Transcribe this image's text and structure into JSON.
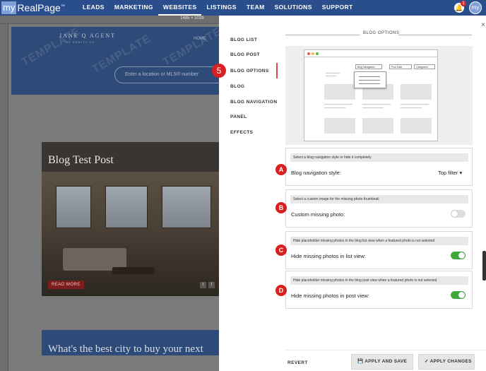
{
  "app": {
    "logo_my": "my",
    "logo_brand": "RealPage",
    "logo_tm": "™",
    "nav": [
      "LEADS",
      "MARKETING",
      "WEBSITES",
      "LISTINGS",
      "TEAM",
      "SOLUTIONS",
      "SUPPORT"
    ],
    "active_nav": "WEBSITES",
    "notification_count": "1",
    "avatar_text": "my"
  },
  "preview": {
    "dimensions": "1485 × 1039",
    "agent_name": "JANE Q AGENT",
    "agent_brand": "THE REALTY CO",
    "home_link": "HOME",
    "watermark": "TEMPLATE",
    "search_placeholder": "Enter a location or MLS® number",
    "blog_title": "Blog Test Post",
    "read_more": "READ MORE",
    "blog2_title": "What's the best city to buy your next"
  },
  "panel": {
    "nav_items": [
      "BLOG LIST",
      "BLOG POST",
      "BLOG OPTIONS",
      "BLOG",
      "BLOG NAVIGATION",
      "PANEL",
      "EFFECTS"
    ],
    "active_item": "BLOG OPTIONS",
    "step_number": "5",
    "close_label": "×",
    "section_title": "BLOG OPTIONS",
    "illustration": {
      "select1": "Blog Navigation",
      "select2": "Post Date",
      "select3": "Categories"
    },
    "options": [
      {
        "marker": "A",
        "hint": "Select a blog navigation style or hide it completely",
        "label": "Blog navigation style:",
        "value": "Top filter",
        "control": "select"
      },
      {
        "marker": "B",
        "hint": "Select a custom image for the missing photo thumbnail",
        "label": "Custom missing photo:",
        "control": "toggle",
        "on": false
      },
      {
        "marker": "C",
        "hint": "Hide placeholder missing photos in the blog list view when a featured photo is not selected",
        "label": "Hide missing photos in list view:",
        "control": "toggle",
        "on": true
      },
      {
        "marker": "D",
        "hint": "Hide placeholder missing photos in the blog post view when a featured photo is not selected",
        "label": "Hide missing photos in post view:",
        "control": "toggle",
        "on": true
      }
    ],
    "footer": {
      "revert": "REVERT",
      "apply_save": "APPLY AND SAVE",
      "apply_changes": "APPLY CHANGES"
    },
    "colors": {
      "toggle_on": "#43a83b",
      "toggle_off": "#dddddd",
      "marker": "#d82020"
    }
  }
}
